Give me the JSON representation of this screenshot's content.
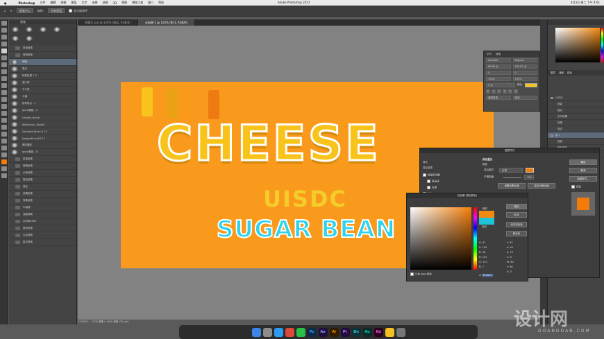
{
  "menubar": {
    "app": "Photoshop",
    "items": [
      "文件",
      "编辑",
      "图像",
      "图层",
      "文字",
      "选择",
      "滤镜",
      "3D",
      "视图",
      "增效工具",
      "窗口",
      "帮助"
    ],
    "title": "Adobe Photoshop 2021",
    "clock": "4月3日 周二 下午 4:01"
  },
  "options": {
    "mode_label": "画笔中心",
    "sample_label": "取样:",
    "sample_value": "所有图层",
    "show_ring": "显示取样环"
  },
  "tabs": [
    "奶酪字.psd @ 100% (图层, RGB/8)",
    "未标题-1 @ 124% (图 3, RGB/8)"
  ],
  "brushes": {
    "title": "画笔",
    "groups": [
      "常用画笔",
      "常规画笔"
    ],
    "items": [
      "硬圆",
      "柔边",
      "特殊效果 1 6",
      "湿介质",
      "干介质",
      "卡通",
      "铅笔笔尖 - 1",
      "gouzi素描 - 6",
      "Ghostly_Brush",
      "Watercolor_Digital",
      "Sampled Brush 6 13",
      "NapperBrushDT-17",
      "硬边圆形",
      "gouzi素描 - 8"
    ],
    "folders": [
      "铅笔画笔",
      "喷溅画笔",
      "水粉画笔",
      "描边画笔",
      "混合",
      "纹理画笔",
      "特殊画笔",
      "Ps画笔",
      "油画笔刷",
      "水彩笔CS6+",
      "面包画笔",
      "云朵笔刷",
      "星空笔刷"
    ]
  },
  "canvas": {
    "headline": "CHEESE",
    "sub": "UISDC",
    "tagline": "SUGAR BEAN",
    "bg": "#f99a1c",
    "stroke_colors": [
      "#f8c41c",
      "#e8a214",
      "#ee7a12"
    ]
  },
  "status": {
    "zoom": "123.64%",
    "size": "2000 像素 x 1000 像素 (72 ppi)"
  },
  "character": {
    "tabs": [
      "字符",
      "段落"
    ],
    "font": "Nexbold",
    "style": "Regular",
    "size": "88.86 点",
    "leading": "180.87 点",
    "tracking": "0",
    "scale_v": "100%",
    "scale_h": "100%",
    "baseline": "0 点",
    "color_label": "颜色:",
    "language": "美国英语",
    "aa": "锐利"
  },
  "layers": {
    "tabs": [
      "图层",
      "通道",
      "路径"
    ],
    "items": [
      "UISDC",
      "投影",
      "描边",
      "文字效果",
      "效果",
      "描边",
      "组 1",
      "投影",
      "颜色叠加",
      "SUGAR BEAN"
    ]
  },
  "layer_style": {
    "title": "图层样式",
    "left_items": [
      "样式",
      "混合选项",
      "斜面和浮雕",
      "等高线",
      "纹理",
      "描边"
    ],
    "section": "颜色叠加",
    "sub": "颜色",
    "blend_label": "混合模式:",
    "blend_value": "正常",
    "opacity_label": "不透明度:",
    "opacity_value": "100",
    "btn_default": "设置为默认值",
    "btn_reset": "复位为默认值",
    "ok": "确定",
    "cancel": "取消",
    "new_style": "新建样式...",
    "preview": "预览"
  },
  "picker": {
    "title": "拾色器 (叠加颜色)",
    "new_label": "新的",
    "current_label": "当前",
    "ok": "确定",
    "cancel": "取消",
    "add_swatch": "添加到色板",
    "libraries": "颜色库",
    "only_web": "只有 Web 颜色",
    "H": "37",
    "S": "100",
    "B": "96",
    "R": "243",
    "G": "123",
    "Bv": "7",
    "L": "67",
    "a": "44",
    "b": "75",
    "C": "0",
    "M": "60",
    "Y": "96",
    "K": "0",
    "hex": "f37b07",
    "new_color": "#f38a10",
    "current_color": "#1fc3d8"
  },
  "dock": [
    "Finder",
    "Launch",
    "Safari",
    "Chrome",
    "WeChat",
    "Ps",
    "Ae",
    "Ai",
    "Pr",
    "Dn",
    "Au",
    "Xd",
    "Games",
    "Trash"
  ],
  "watermark": {
    "main": "设计网",
    "sub": "DOANDOAN.COM"
  }
}
